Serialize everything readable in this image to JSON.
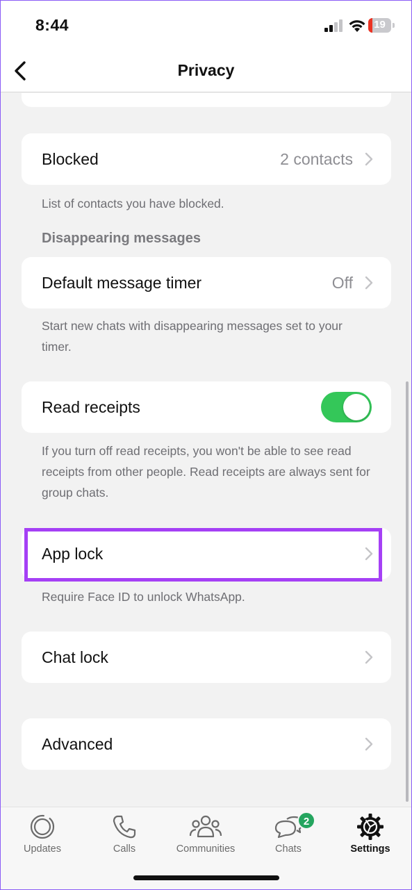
{
  "status_bar": {
    "time": "8:44",
    "battery_level": "19",
    "battery_fraction": 0.19,
    "battery_color": "#eb3323"
  },
  "nav": {
    "title": "Privacy",
    "back_icon": "chevron-left-icon"
  },
  "rows": {
    "blocked": {
      "label": "Blocked",
      "value": "2 contacts",
      "footnote": "List of contacts you have blocked."
    },
    "disappearing_header": "Disappearing messages",
    "default_timer": {
      "label": "Default message timer",
      "value": "Off",
      "footnote": "Start new chats with disappearing messages set to your timer."
    },
    "read_receipts": {
      "label": "Read receipts",
      "toggle_on": true,
      "footnote": "If you turn off read receipts, you won't be able to see read receipts from other people. Read receipts are always sent for group chats."
    },
    "app_lock": {
      "label": "App lock",
      "footnote": "Require Face ID to unlock WhatsApp."
    },
    "chat_lock": {
      "label": "Chat lock"
    },
    "advanced": {
      "label": "Advanced"
    }
  },
  "tabs": [
    {
      "label": "Updates",
      "icon": "updates-icon"
    },
    {
      "label": "Calls",
      "icon": "phone-icon"
    },
    {
      "label": "Communities",
      "icon": "communities-icon"
    },
    {
      "label": "Chats",
      "icon": "chat-bubbles-icon",
      "badge": "2"
    },
    {
      "label": "Settings",
      "icon": "gear-icon",
      "active": true
    }
  ],
  "colors": {
    "toggle_on": "#34c759",
    "badge": "#25a55f",
    "highlight": "#a540f5"
  }
}
